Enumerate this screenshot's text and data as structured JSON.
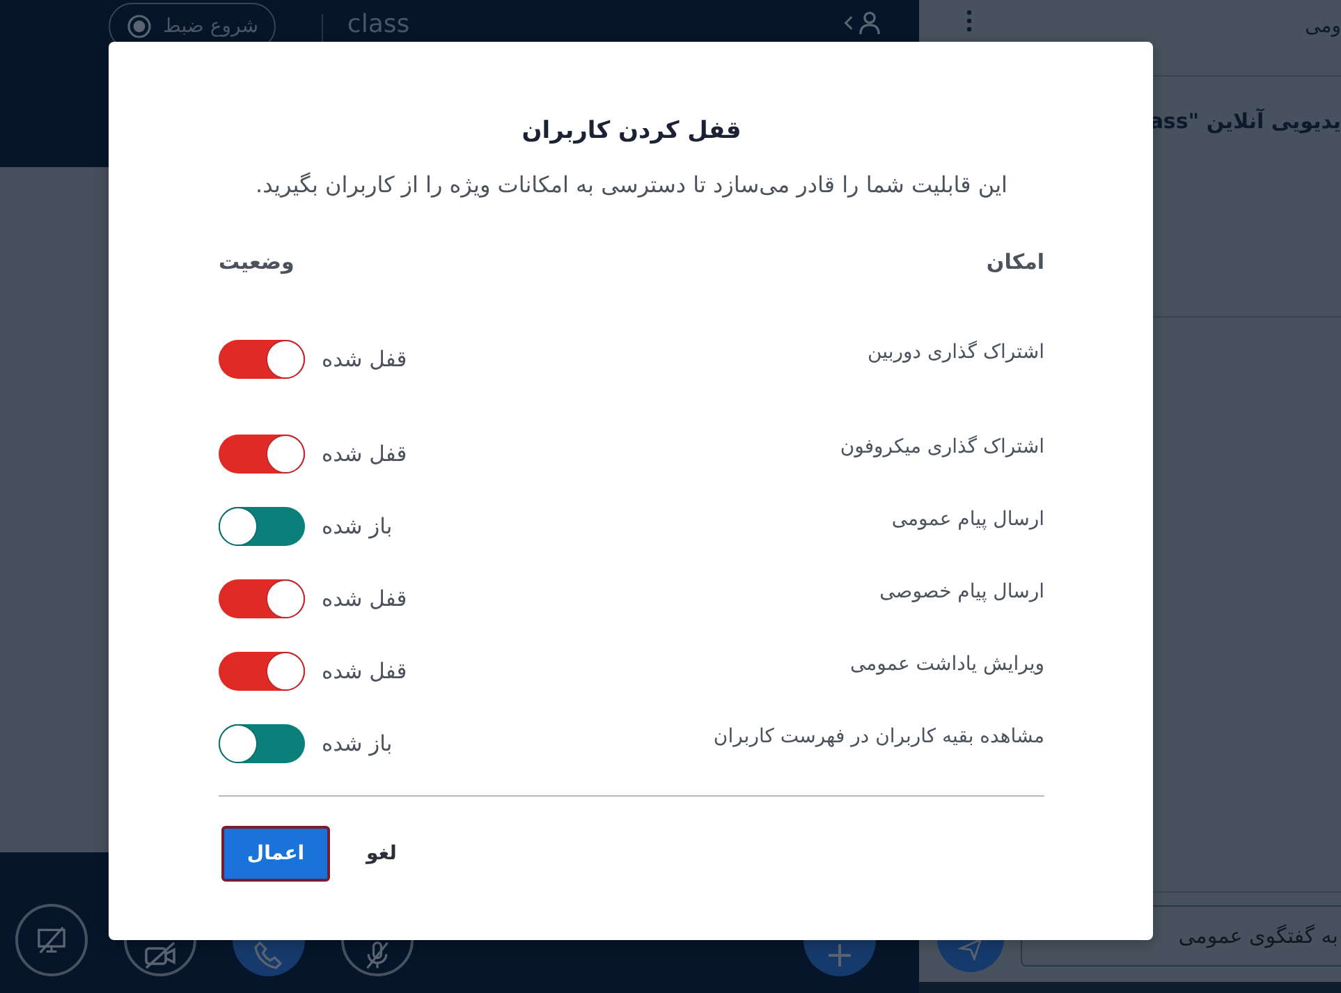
{
  "top_bar": {
    "record_button": {
      "label": "شروع ضبط"
    },
    "class_name": "class"
  },
  "side_panel": {
    "header_title": "ومی",
    "message": "یدیویی آنلاین \"ass",
    "chat_input": {
      "placeholder": "به گفتگوی عمومی"
    }
  },
  "dialog": {
    "title": "قفل کردن کاربران",
    "description": "این قابلیت شما را قادر می‌سازد تا دسترسی به امکانات ویژه را از کاربران بگیرید.",
    "columns": {
      "feature": "امکان",
      "status": "وضعیت"
    },
    "rows": [
      {
        "label": "اشتراک گذاری دوربین",
        "status": "قفل شده",
        "locked": true
      },
      {
        "label": "اشتراک گذاری میکروفون",
        "status": "قفل شده",
        "locked": true
      },
      {
        "label": "ارسال پیام عمومی",
        "status": "باز شده",
        "locked": false
      },
      {
        "label": "ارسال پیام خصوصی",
        "status": "قفل شده",
        "locked": true
      },
      {
        "label": "ویرایش یاداشت عمومی",
        "status": "قفل شده",
        "locked": true
      },
      {
        "label": "مشاهده بقیه کاربران در فهرست کاربران",
        "status": "باز شده",
        "locked": false
      }
    ],
    "buttons": {
      "apply": "اعمال",
      "cancel": "لغو"
    }
  }
}
